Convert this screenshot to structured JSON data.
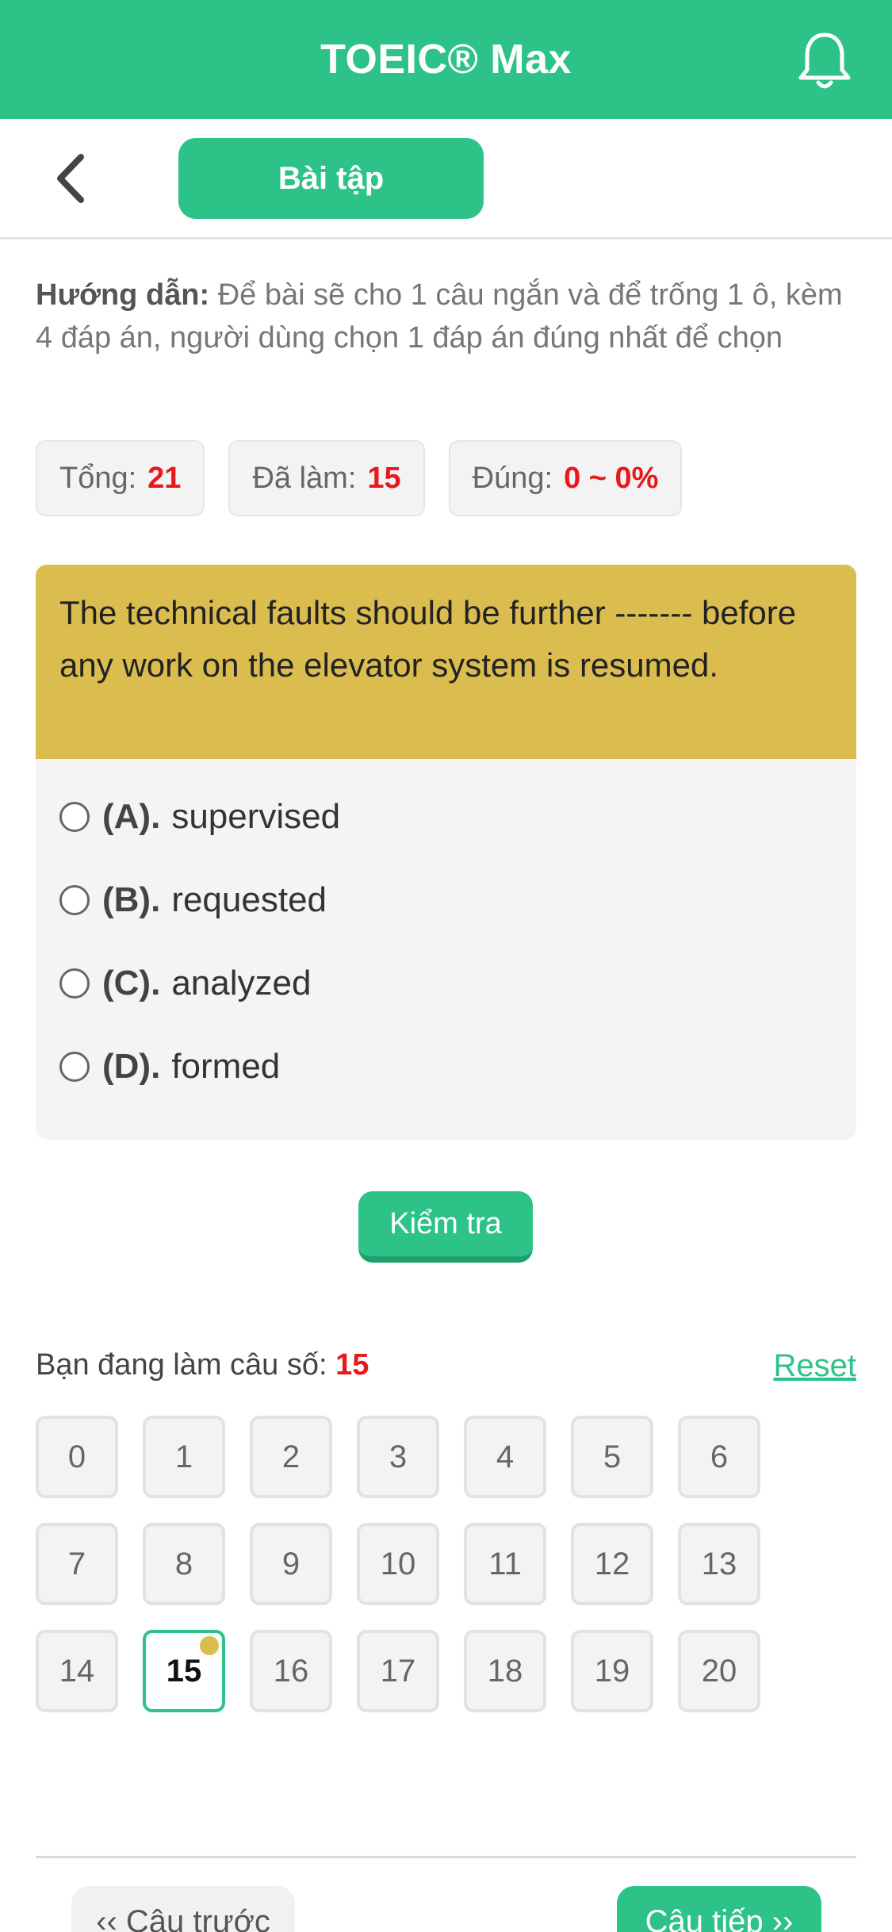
{
  "app": {
    "title": "TOEIC® Max"
  },
  "subnav": {
    "tab_label": "Bài tập"
  },
  "instructions": {
    "label": "Hướng dẫn:",
    "text": " Để bài sẽ cho 1 câu ngắn và để trống 1 ô, kèm 4 đáp án, người dùng chọn 1 đáp án đúng nhất để chọn"
  },
  "stats": {
    "total_label": "Tổng:",
    "total_value": "21",
    "done_label": "Đã làm:",
    "done_value": "15",
    "correct_label": "Đúng:",
    "correct_value": "0 ~ 0%"
  },
  "question": {
    "text": "The technical faults should be further ------- before any work on the elevator system is resumed.",
    "options": [
      {
        "letter": "(A).",
        "text": "supervised"
      },
      {
        "letter": "(B).",
        "text": "requested"
      },
      {
        "letter": "(C).",
        "text": "analyzed"
      },
      {
        "letter": "(D).",
        "text": "formed"
      }
    ]
  },
  "check_button": "Kiểm tra",
  "progress": {
    "label": "Bạn đang làm câu số: ",
    "current": "15",
    "reset": "Reset"
  },
  "question_numbers": [
    "0",
    "1",
    "2",
    "3",
    "4",
    "5",
    "6",
    "7",
    "8",
    "9",
    "10",
    "11",
    "12",
    "13",
    "14",
    "15",
    "16",
    "17",
    "18",
    "19",
    "20"
  ],
  "current_index": 15,
  "nav": {
    "prev": "‹‹ Câu trước",
    "next": "Câu tiếp ››"
  },
  "colors": {
    "brand": "#2dc388",
    "question_bg": "#dbbd4f",
    "accent_red": "#e8191c"
  },
  "icons": {
    "bell": "bell-icon",
    "back": "chevron-left-icon"
  }
}
